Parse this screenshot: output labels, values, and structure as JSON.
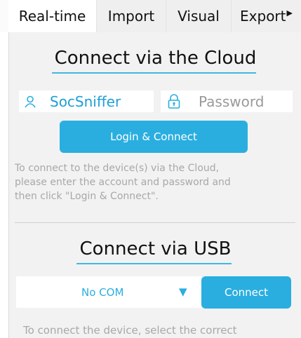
{
  "tabs": [
    {
      "label": "Real-time",
      "active": true
    },
    {
      "label": "Import"
    },
    {
      "label": "Visual"
    },
    {
      "label": "Export"
    }
  ],
  "cloud": {
    "title": "Connect via the Cloud",
    "username_value": "SocSniffer",
    "password_placeholder": "Password",
    "login_button": "Login & Connect",
    "help_lines": [
      "To connect to the device(s) via the Cloud,",
      "please enter the account and password and",
      "then click \"Login & Connect\"."
    ]
  },
  "usb": {
    "title": "Connect via USB",
    "com_selected": "No COM",
    "connect_button": "Connect",
    "help_lines": [
      "To connect the device, select the correct"
    ]
  },
  "colors": {
    "accent": "#2aaee0",
    "panel_bg": "#f2f2f2",
    "help_text": "#a8a8a8"
  },
  "icons": [
    "user-icon",
    "lock-icon",
    "dropdown-arrow-icon",
    "tab-scroll-right-icon"
  ]
}
